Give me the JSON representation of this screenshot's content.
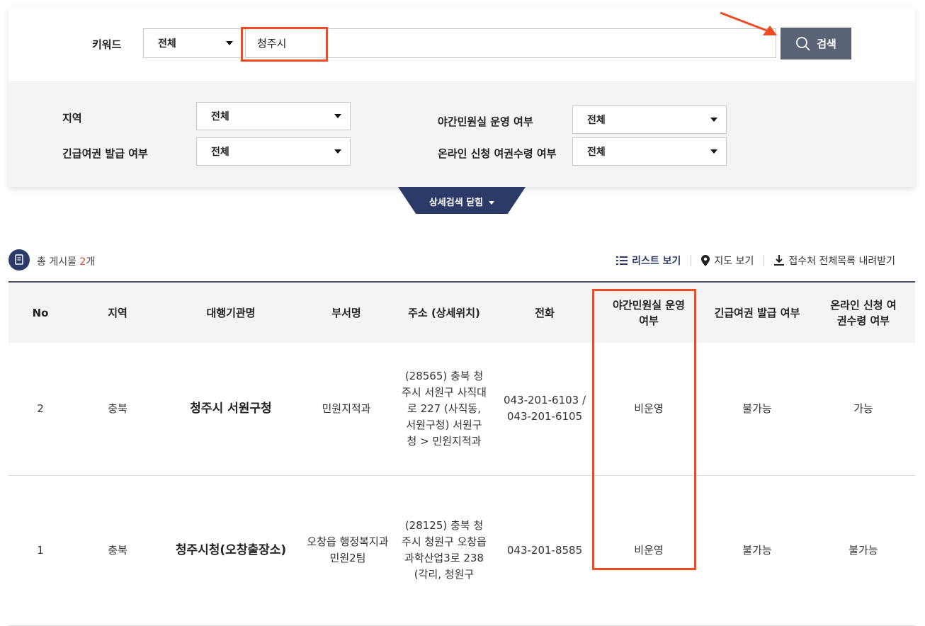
{
  "search": {
    "keyword_label": "키워드",
    "keyword_scope": "전체",
    "keyword_value": "청주시",
    "search_button": "검색"
  },
  "filters": {
    "region_label": "지역",
    "region_value": "전체",
    "emergency_label": "긴급여권 발급 여부",
    "emergency_value": "전체",
    "night_label": "야간민원실 운영 여부",
    "night_value": "전체",
    "online_label": "온라인 신청 여권수령 여부",
    "online_value": "전체",
    "toggle_label": "상세검색 닫힘"
  },
  "list": {
    "count_prefix": "총 게시물 ",
    "count_num": "2",
    "count_suffix": "개",
    "list_view": "리스트 보기",
    "map_view": "지도 보기",
    "download": "접수처 전체목록 내려받기"
  },
  "table": {
    "headers": [
      "No",
      "지역",
      "대행기관명",
      "부서명",
      "주소 (상세위치)",
      "전화",
      "야간민원실 운영 여부",
      "긴급여권 발급 여부",
      "온라인 신청 여권수령 여부"
    ],
    "rows": [
      {
        "no": "2",
        "region": "충북",
        "org": "청주시 서원구청",
        "dept": "민원지적과",
        "address": "(28565) 충북 청주시 서원구 사직대로 227 (사직동, 서원구청) 서원구청 > 민원지적과",
        "phone": "043-201-6103 / 043-201-6105",
        "night": "비운영",
        "emergency": "불가능",
        "online": "가능"
      },
      {
        "no": "1",
        "region": "충북",
        "org": "청주시청(오창출장소)",
        "dept": "오창읍 행정복지과 민원2팀",
        "address": "(28125) 충북 청주시 청원구 오창읍 과학산업3로 238 (각리, 청원구",
        "phone": "043-201-8585",
        "night": "비운영",
        "emergency": "불가능",
        "online": "불가능"
      }
    ]
  },
  "colors": {
    "highlight": "#f04a23",
    "navy": "#2b3a67",
    "button": "#5a6275"
  }
}
